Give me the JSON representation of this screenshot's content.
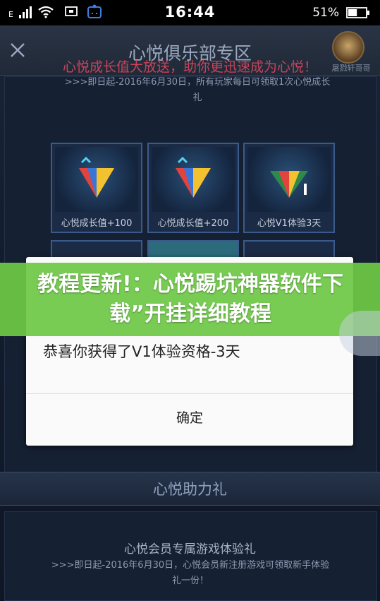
{
  "status_bar": {
    "network_label": "E",
    "time": "16:44",
    "battery_percent": "51%",
    "battery_level": 0.51
  },
  "header": {
    "title": "心悦俱乐部专区",
    "avatar_label": "屠戮轩哥哥"
  },
  "promo": {
    "title": "心悦成长值大放送，助你更迅速成为心悦！",
    "subtitle": ">>>即日起-2016年6月30日，所有玩家每日可领取1次心悦成长礼"
  },
  "cards": [
    {
      "label": "心悦成长值+100",
      "icon": "gift-gem-icon"
    },
    {
      "label": "心悦成长值+200",
      "icon": "gift-gem-icon"
    },
    {
      "label": "心悦V1体验3天",
      "icon": "vip-gem-icon"
    }
  ],
  "dialog": {
    "message": "恭喜你获得了V1体验资格-3天",
    "confirm_label": "确定"
  },
  "banner": {
    "text": "教程更新!：心悦踢坑神器软件下载”开挂详细教程"
  },
  "section2": {
    "title": "心悦助力礼",
    "item_title": "心悦会员专属游戏体验礼",
    "item_subtitle": ">>>即日起-2016年6月30日，心悦会员新注册游戏可领取新手体验礼一份！"
  },
  "colors": {
    "accent_red": "#c9435a",
    "banner_green": "#6ec846",
    "card_border": "#3b5a8c"
  }
}
